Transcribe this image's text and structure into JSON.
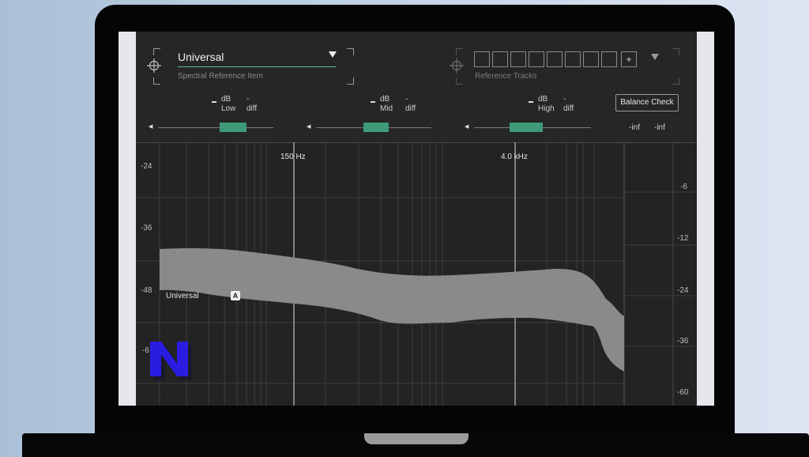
{
  "preset": {
    "name": "Universal",
    "caption": "Spectral Reference Item"
  },
  "reference": {
    "caption": "Reference Tracks",
    "slot_count": 8,
    "add_label": "+"
  },
  "bands": [
    {
      "name": "Low",
      "unit": "dB",
      "value": "-",
      "dash_label": "-",
      "diff_label": "diff"
    },
    {
      "name": "Mid",
      "unit": "dB",
      "value": "-",
      "dash_label": "-",
      "diff_label": "diff"
    },
    {
      "name": "High",
      "unit": "dB",
      "value": "-",
      "dash_label": "-",
      "diff_label": "diff"
    }
  ],
  "balance_check_label": "Balance Check",
  "meters": {
    "left": "-inf",
    "right": "-inf"
  },
  "graph": {
    "freq_markers": [
      "150 Hz",
      "4.0 kHz"
    ],
    "left_scale": [
      "-24",
      "-36",
      "-48",
      "-6"
    ],
    "right_scale": [
      "-6",
      "-12",
      "-24",
      "-36",
      "-60"
    ],
    "curve_label": "Universal",
    "curve_badge": "A"
  },
  "colors": {
    "accent": "#3e9a77",
    "panel": "#242424",
    "curve": "#8a8a8a"
  },
  "icons": {
    "target": "crosshair-icon",
    "dropdown": "chevron-down-icon",
    "logo": "n-logo-icon"
  }
}
